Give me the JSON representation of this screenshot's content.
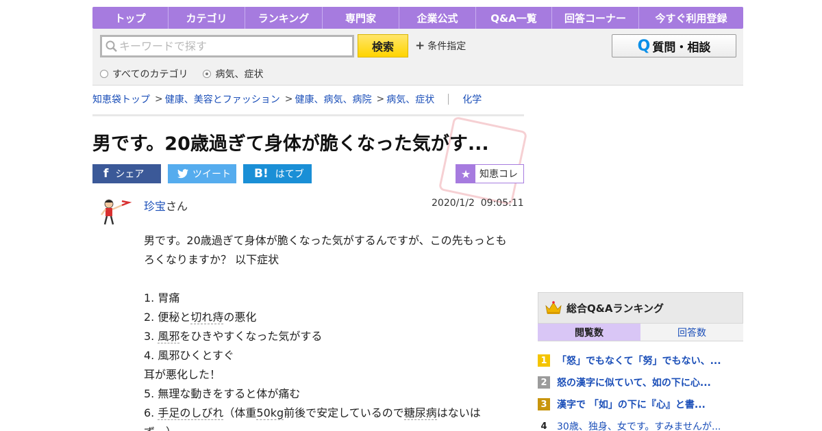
{
  "nav": {
    "items": [
      "トップ",
      "カテゴリ",
      "ランキング",
      "専門家",
      "企業公式",
      "Q&A一覧",
      "回答コーナー",
      "今すぐ利用登録"
    ]
  },
  "search": {
    "placeholder": "キーワードで探す",
    "button": "検索",
    "condition": "条件指定",
    "ask_button": "質問・相談",
    "radio_all": "すべてのカテゴリ",
    "radio_cat": "病気、症状",
    "selected": "病気、症状"
  },
  "breadcrumb": {
    "items": [
      "知恵袋トップ",
      "健康、美容とファッション",
      "健康、病気、病院",
      "病気、症状"
    ],
    "separator": ">",
    "tag": "化学"
  },
  "question": {
    "title": "男です。20歳過ぎて身体が脆くなった気がす...",
    "user": "珍宝",
    "user_suffix": "さん",
    "date": "2020/1/2  09:05:11",
    "body": {
      "l1": "男です。20歳過ぎて身体が脆くなった気がするんですが、この先もっとも",
      "l2": "ろくなりますか？ 以下症状",
      "i1": "1. 胃痛",
      "i2a": "2. 便秘と",
      "i2b": "切れ痔",
      "i2c": "の悪化",
      "i3a": "3. ",
      "i3b": "風邪",
      "i3c": "をひきやすくなった気がする",
      "i4": "4. 風邪ひくとすぐ",
      "i4b": "耳が悪化した！",
      "i5": "5. 無理な動きをすると体が痛む",
      "i6a": "6. ",
      "i6b": "手足のしびれ",
      "i6c": "（体重",
      "i6d": "50kg",
      "i6e": "前後で安定しているので",
      "i6f": "糖尿病",
      "i6g": "はないは",
      "i6h": "ず…）"
    }
  },
  "share": {
    "facebook": "シェア",
    "twitter": "ツイート",
    "hatena": "はてブ",
    "hatena_icon": "B!",
    "chie": "知恵コレ"
  },
  "ranking": {
    "title": "総合Q&Aランキング",
    "tab_views": "閲覧数",
    "tab_answers": "回答数",
    "items": [
      {
        "rank": "1",
        "text": "「怒」でもなくて「努」でもない、..."
      },
      {
        "rank": "2",
        "text": "怒の漢字に似ていて、如の下に心..."
      },
      {
        "rank": "3",
        "text": "漢字で 「如」の下に『心』と書..."
      },
      {
        "rank": "4",
        "text": "30歳、独身、女です。すみませんが..."
      }
    ]
  },
  "colors": {
    "nav": "#a67bdf",
    "search_button": "#ffd400",
    "link": "#1a4eb8",
    "facebook": "#3b5998",
    "twitter": "#55acee",
    "hatena": "#1a8fd6"
  }
}
